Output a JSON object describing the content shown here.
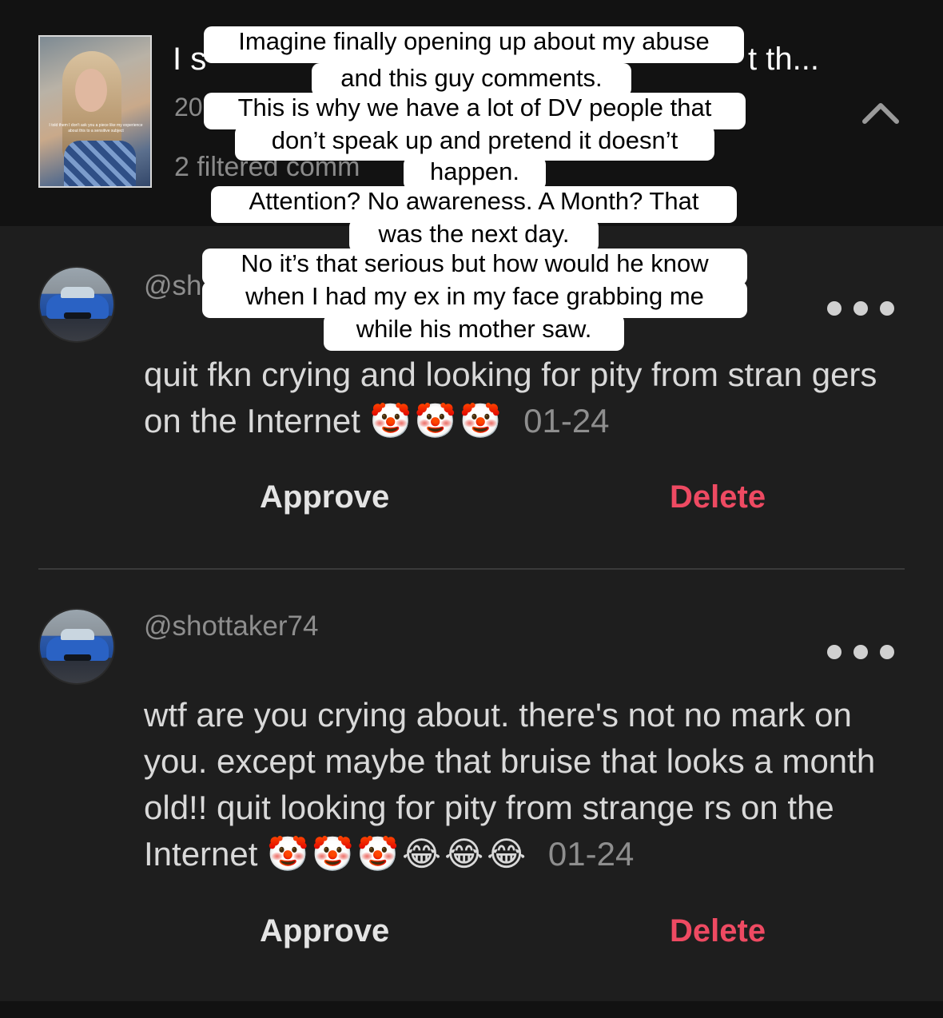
{
  "header": {
    "video_title_start": "I s",
    "video_title_end": "t th...",
    "video_date": "20",
    "filtered_comments": "2 filtered comm",
    "thumbnail_caption": "I told them I don't ask you a piece like my experience about this to a sensitive subject"
  },
  "comments": [
    {
      "username": "@sh",
      "text": "quit fkn crying and looking for pity from stran gers on the Internet",
      "emojis": "🤡🤡🤡",
      "date": "01-24",
      "approve_label": "Approve",
      "delete_label": "Delete"
    },
    {
      "username": "@shottaker74",
      "text": "wtf are you crying about. there's not no mark on you. except maybe that bruise that looks a month old!! quit looking for pity from strange rs on the Internet",
      "emojis": "🤡🤡🤡😂😂😂",
      "date": "01-24",
      "approve_label": "Approve",
      "delete_label": "Delete"
    }
  ],
  "overlay_lines": [
    "Imagine finally opening up about my abuse",
    "and this guy comments.",
    "This is why we have a lot of DV people that",
    "don’t speak up and pretend it doesn’t",
    "happen.",
    "Attention? No awareness. A Month? That",
    "was the next day.",
    "No it’s that serious but how would he know",
    "when I had my ex in my face grabbing me",
    "while his mother saw."
  ],
  "colors": {
    "background": "#121212",
    "panel": "#1e1e1e",
    "delete": "#ee4a62",
    "muted": "#8e8e8e"
  }
}
